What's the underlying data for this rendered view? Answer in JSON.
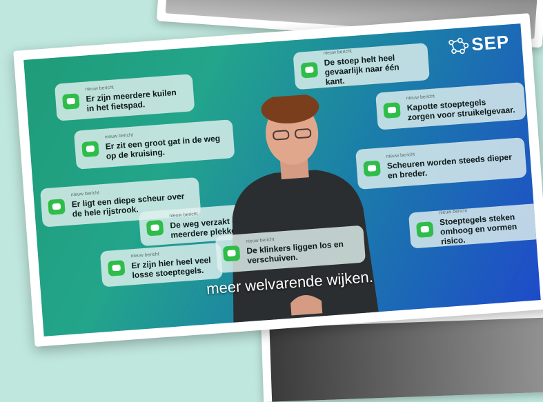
{
  "brand": {
    "logo_text": "SEP"
  },
  "cards": [
    {
      "caption": "nieuw bericht",
      "message": "Er zijn meerdere kuilen in het fietspad."
    },
    {
      "caption": "nieuw bericht",
      "message": "Er zit een groot gat in de weg op de kruising."
    },
    {
      "caption": "nieuw bericht",
      "message": "Er ligt een diepe scheur over de hele rijstrook."
    },
    {
      "caption": "nieuw bericht",
      "message": "De weg verzakt op meerdere plekken."
    },
    {
      "caption": "nieuw bericht",
      "message": "Er zijn hier heel veel losse stoeptegels."
    },
    {
      "caption": "nieuw bericht",
      "message": "De klinkers liggen los en verschuiven."
    },
    {
      "caption": "nieuw bericht",
      "message": "De stoep helt heel gevaarlijk naar één kant."
    },
    {
      "caption": "nieuw bericht",
      "message": "Kapotte stoeptegels zorgen voor struikelgevaar."
    },
    {
      "caption": "nieuw bericht",
      "message": "Scheuren worden steeds dieper en breder."
    },
    {
      "caption": "nieuw bericht",
      "message": "Stoeptegels steken omhoog en vormen risico."
    }
  ],
  "subtitle": "meer welvarende wijken.",
  "colors": {
    "background": "#bfe7dd",
    "chat_icon": "#2fbd4a",
    "gradient_start": "#1f9c78",
    "gradient_end": "#1e4bc9"
  }
}
